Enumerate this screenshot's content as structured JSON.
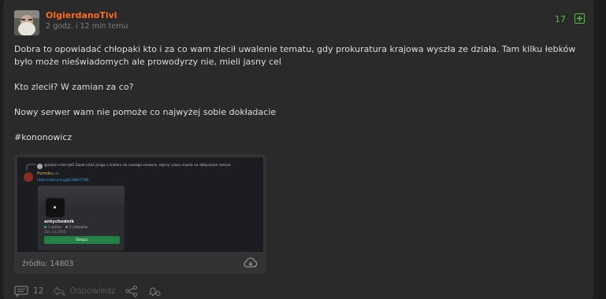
{
  "post": {
    "username": "OlgierdanoTivi",
    "timestamp": "2 godz. i 12 min temu",
    "votes": "17",
    "paragraphs": [
      "Dobra to opowiadać chłopaki kto i za co wam zlecił uwalenie tematu, gdy prokuratura krajowa wyszła ze działa. Tam kilku łebków było może nieświadomych ale prowodyrzy nie, mieli jasny cel",
      "Kto zlecił? W zamian za co?",
      "Nowy serwer wam nie pomoże co najwyżej sobie dokładacie",
      "#kononowicz"
    ],
    "embed": {
      "source": "źródło: 14803",
      "screenshot": {
        "reply_line": "@adam-r.kerryb0 Zajeb kitoć pinga z linkiem do nowego serwera, dajmy czasu chwila na dołączenie reszcie",
        "author": "Formbi",
        "author_tag": "zrzu",
        "link": "https://discord.gg/b3KKhY78R",
        "server_name": "antychodnik",
        "online": "1 online",
        "members": "2 członków",
        "founded": "Zał. sut 2024",
        "join_label": "Dołącz"
      }
    },
    "footer": {
      "comments": "12",
      "reply_label": "Odpowiedz"
    }
  },
  "colors": {
    "username": "#ff6a1a",
    "votes": "#4fbf3f",
    "background": "#2a2a2a"
  }
}
